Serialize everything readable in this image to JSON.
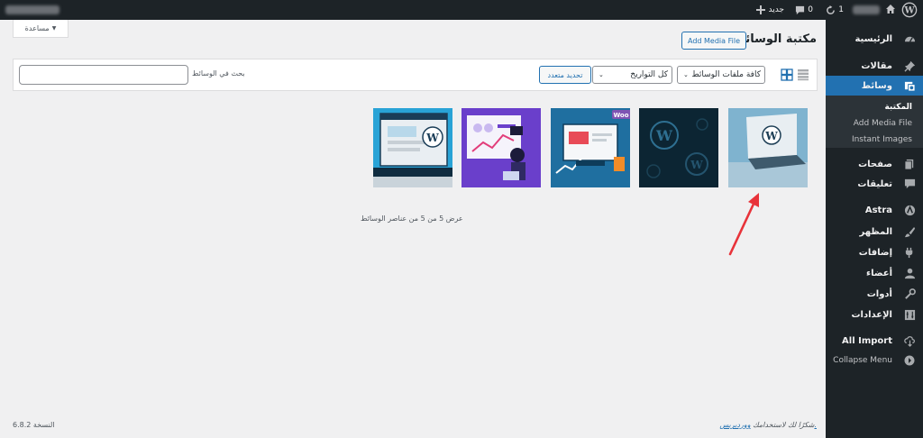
{
  "adminbar": {
    "new_label": "جديد",
    "comments_count": "0",
    "updates_count": "1"
  },
  "sidebar": {
    "items": [
      {
        "label": "الرئيسية",
        "icon": "dashboard-icon"
      },
      {
        "label": "مقالات",
        "icon": "pin-icon"
      },
      {
        "label": "وسائط",
        "icon": "media-icon"
      },
      {
        "label": "صفحات",
        "icon": "pages-icon"
      },
      {
        "label": "تعليقات",
        "icon": "comments-icon"
      },
      {
        "label": "Astra",
        "icon": "astra-icon"
      },
      {
        "label": "المظهر",
        "icon": "appearance-icon"
      },
      {
        "label": "إضافات",
        "icon": "plugins-icon"
      },
      {
        "label": "أعضاء",
        "icon": "users-icon"
      },
      {
        "label": "أدوات",
        "icon": "tools-icon"
      },
      {
        "label": "الإعدادات",
        "icon": "settings-icon"
      },
      {
        "label": "All Import",
        "icon": "import-icon"
      },
      {
        "label": "Collapse Menu",
        "icon": "collapse-icon"
      }
    ],
    "submenu": [
      "المكتبة",
      "Add Media File",
      "Instant Images"
    ]
  },
  "help_tab": "مساعدة",
  "page_title": "مكتبة الوسائط",
  "add_media_button": "Add Media File",
  "toolbar": {
    "type_filter": "كافة ملفات الوسائط",
    "date_filter": "كل التواريخ",
    "bulk_select": "تحديد متعدد",
    "search_label": "بحث في الوسائط",
    "search_value": ""
  },
  "media_count_text": "عرض 5 من 5 من عناصر الوسائط",
  "footer": {
    "thanks_prefix": "شكرًا لك لاستخدامك",
    "thanks_link": "ووردبريس.",
    "version": "النسخة 6.8.2"
  },
  "colors": {
    "admin_dark": "#1d2327",
    "accent_blue": "#2271b1",
    "arrow_red": "#e8333a"
  }
}
